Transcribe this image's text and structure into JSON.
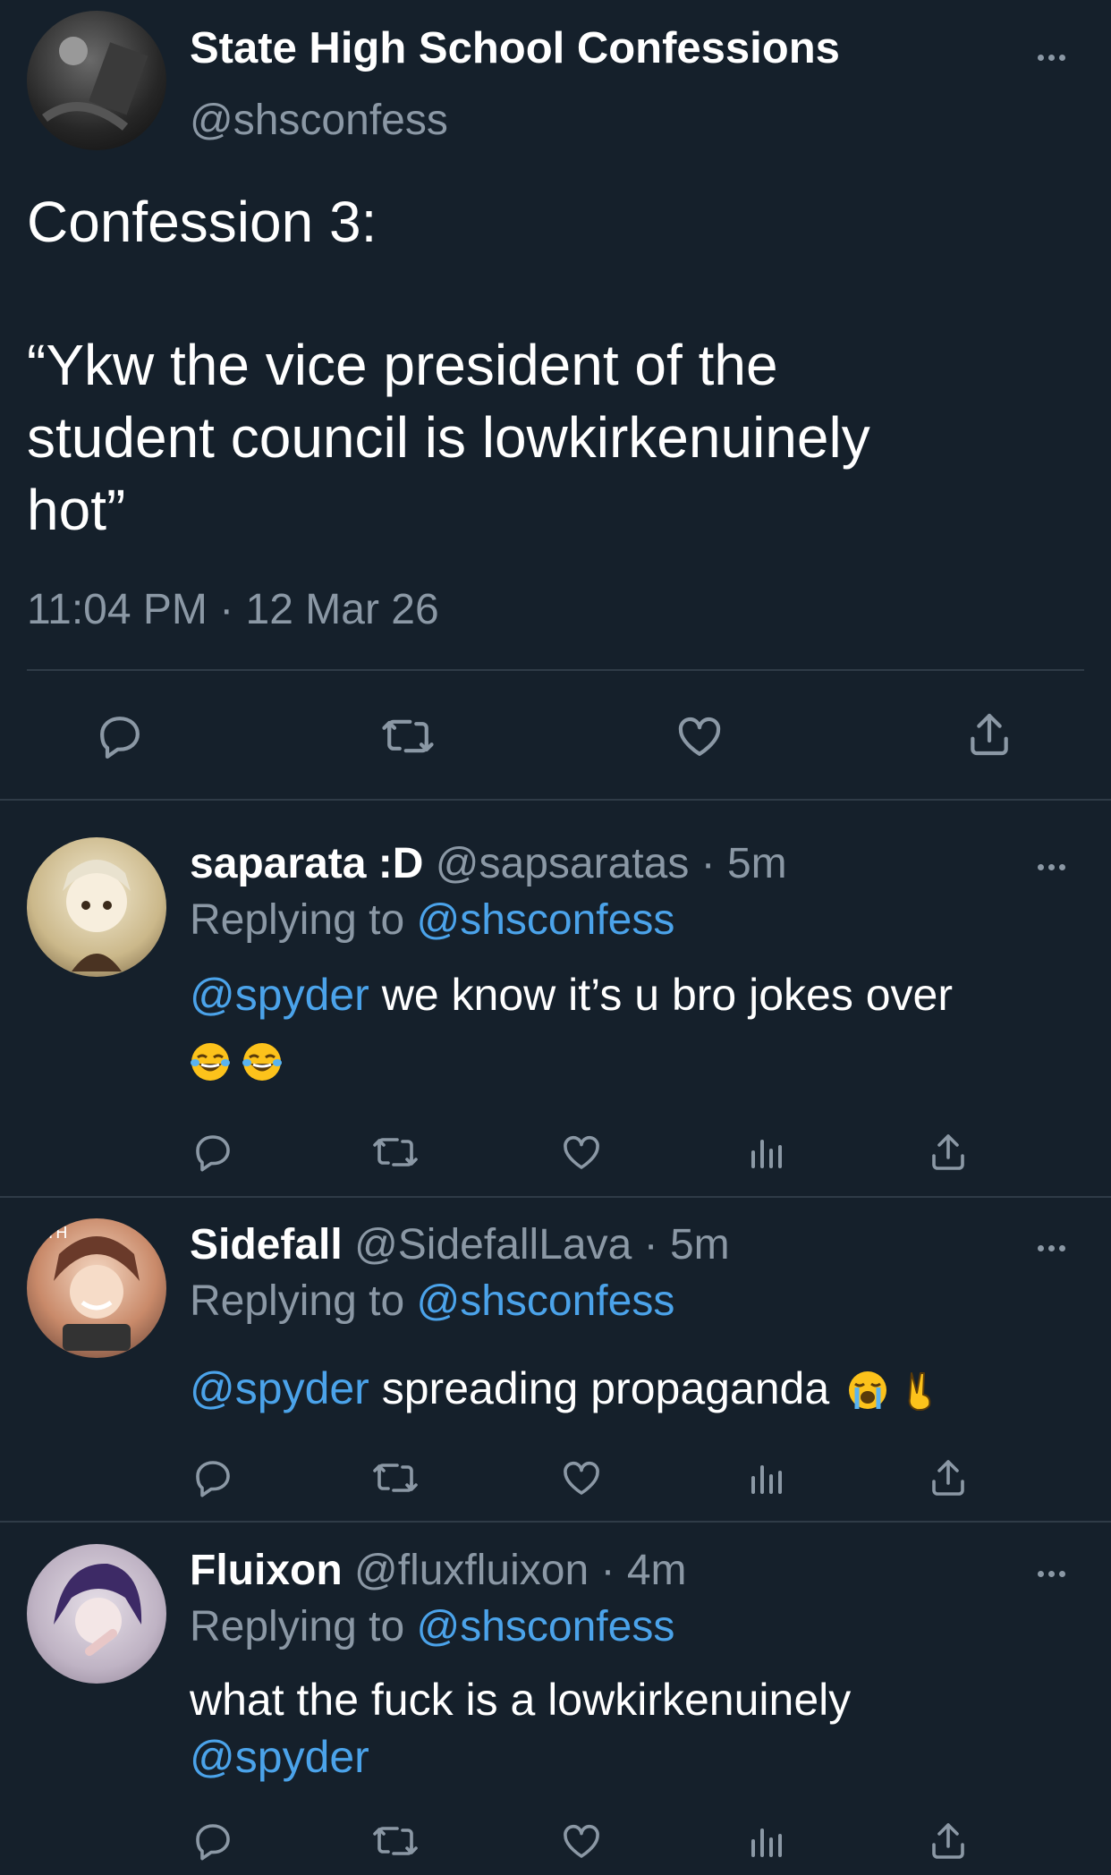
{
  "main_tweet": {
    "display_name": "State High School Confessions",
    "handle": "@shsconfess",
    "heading": "Confession 3:",
    "quote_lines": [
      "“Ykw the vice president of the",
      "student council is lowkirkenuinely",
      "hot”"
    ],
    "timestamp": "11:04 PM · 12 Mar 26"
  },
  "replies": [
    {
      "display_name": "saparata :D",
      "meta": "@sapsaratas · 5m",
      "replying_prefix": "Replying to",
      "replying_handle": "@shsconfess",
      "mention": "@spyder",
      "text": "we know it’s u bro jokes over"
    },
    {
      "display_name": "Sidefall",
      "meta": "@SidefallLava · 5m",
      "replying_prefix": "Replying to",
      "replying_handle": "@shsconfess",
      "mention": "@spyder",
      "text": "spreading propaganda"
    },
    {
      "display_name": "Fluixon",
      "meta": "@fluxfluixon · 4m",
      "replying_prefix": "Replying to",
      "replying_handle": "@shsconfess",
      "text": "what the fuck is a lowkirkenuinely",
      "mention": "@spyder"
    }
  ],
  "icons": [
    "reply-icon",
    "retweet-icon",
    "like-icon",
    "views-icon",
    "share-icon",
    "more-icon"
  ],
  "colors": {
    "background": "#15202b",
    "link": "#4ba3ea",
    "muted": "#8b98a5",
    "divider": "#2f3b47"
  }
}
